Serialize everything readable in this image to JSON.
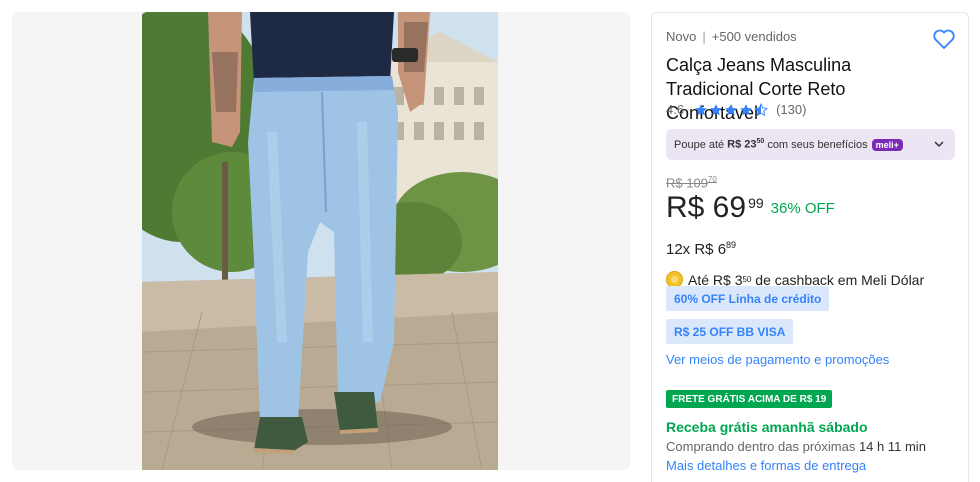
{
  "product": {
    "condition": "Novo",
    "sold": "+500 vendidos",
    "title": "Calça Jeans Masculina Tradicional Corte Reto Confortável",
    "rating_value": "4.6",
    "rating_stars": 4.5,
    "review_count": "(130)"
  },
  "savings": {
    "prefix": "Poupe até",
    "amount": "R$ 23",
    "cents": "50",
    "suffix": "com seus benefícios",
    "badge": "meli+"
  },
  "pricing": {
    "old_price": "R$ 109",
    "old_cents": "70",
    "price": "R$ 69",
    "price_cents": "99",
    "discount": "36% OFF",
    "installments": "12x R$ 6",
    "installments_cents": "89"
  },
  "cashback": {
    "prefix": "Até R$ 3",
    "cents": "50",
    "suffix": " de cashback em Meli Dólar"
  },
  "promos": {
    "credit": "60% OFF Linha de crédito",
    "bb": "R$ 25 OFF BB VISA"
  },
  "links": {
    "payments": "Ver meios de pagamento e promoções",
    "delivery_details": "Mais detalhes e formas de entrega"
  },
  "shipping": {
    "badge": "FRETE GRÁTIS ACIMA DE R$ 19",
    "arrival": "Receba grátis amanhã sábado",
    "countdown_prefix": "Comprando dentro das próximas",
    "countdown_time": "14 h 11 min"
  },
  "colors": {
    "accent": "#3483fa",
    "green": "#00a650",
    "meli_purple": "#7b2ab8",
    "star": "#3483fa"
  }
}
